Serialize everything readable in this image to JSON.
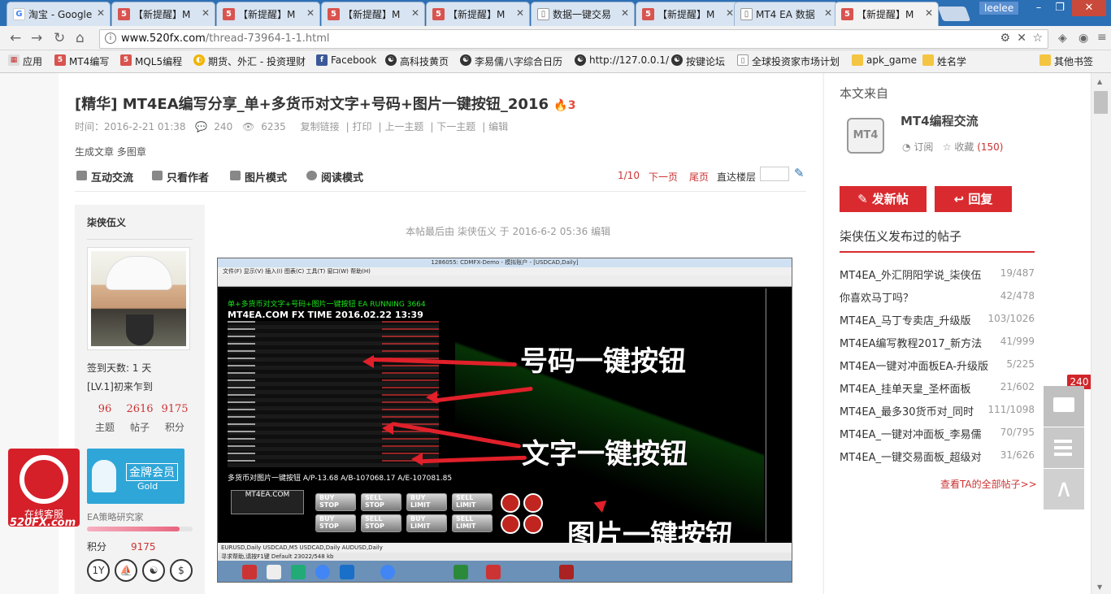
{
  "browser": {
    "tabs": [
      {
        "icon": "G",
        "label": "淘宝 - Google"
      },
      {
        "icon": "5",
        "label": "【新提醒】M"
      },
      {
        "icon": "5",
        "label": "【新提醒】M"
      },
      {
        "icon": "5",
        "label": "【新提醒】M"
      },
      {
        "icon": "5",
        "label": "【新提醒】M"
      },
      {
        "icon": "doc",
        "label": "数据一键交易"
      },
      {
        "icon": "5",
        "label": "【新提醒】M"
      },
      {
        "icon": "doc",
        "label": "MT4 EA 数据"
      },
      {
        "icon": "5",
        "label": "【新提醒】M"
      }
    ],
    "user": "leelee",
    "url_host": "www.520fx.com",
    "url_path": "/thread-73964-1-1.html",
    "bookmarks": [
      "应用",
      "MT4编写",
      "MQL5编程",
      "期货、外汇 - 投资理财",
      "Facebook",
      "高科技黄页",
      "李易儒八字综合日历",
      "http://127.0.0.1/",
      "按键论坛",
      "全球投资家市场计划",
      "apk_game",
      "姓名学",
      "其他书签"
    ]
  },
  "thread": {
    "title": "[精华] MT4EA编写分享_单+多货币对文字+号码+图片一键按钮_2016",
    "hot_icon": "fire-icon",
    "time": "时间：2016-2-21 01:38",
    "replies": "240",
    "views": "6235",
    "actions": [
      "复制链接",
      "打印",
      "上一主题",
      "下一主题",
      "编辑"
    ],
    "tags": "生成文章 多图章",
    "tools": [
      "互动交流",
      "只看作者",
      "图片模式",
      "阅读模式"
    ],
    "pager": {
      "page": "1/10",
      "next": "下一页",
      "last": "尾页",
      "jump": "直达楼层"
    },
    "edited_note": "本帖最后由 柒侠伍义 于 2016-6-2 05:36 编辑"
  },
  "author": {
    "name": "柒侠伍义",
    "sign_days": "签到天数: 1 天",
    "level": "[LV.1]初来乍到",
    "stats": [
      {
        "value": "96",
        "label": "主题"
      },
      {
        "value": "2616",
        "label": "帖子"
      },
      {
        "value": "9175",
        "label": "积分"
      }
    ],
    "medal_title": "金牌会员",
    "medal_sub": "Gold",
    "group": "EA策略研究家",
    "progress": 0.88,
    "score_label": "积分",
    "score_value": "9175",
    "badges": [
      "1Y",
      "⛵",
      "☯",
      "$"
    ]
  },
  "screenshot": {
    "window_title": "1286055: CDMFX-Demo - 模拟账户 - [USDCAD,Daily]",
    "menu": "文件(F)  显示(V)  插入(I)  图表(C)  工具(T)  窗口(W)  帮助(H)",
    "header_line1": "单+多货币对文字+号码+图片一键按钮 EA RUNNING  3664",
    "header_line2": "MT4EA.COM   FX TIME   2016.02.22 13:39",
    "footer": "多货币对图片一键按钮     A/P-13.68     A/B-107068.17   A/E-107081.85",
    "buttons": [
      "BUY STOP",
      "SELL STOP",
      "BUY LIMIT",
      "SELL LIMIT",
      "BUY STOP",
      "SELL STOP",
      "BUY LIMIT",
      "SELL LIMIT"
    ],
    "logo_text": "MT4EA.COM",
    "tabs": "EURUSD,Daily   USDCAD,M5   USDCAD,Daily   AUDUSD,Daily",
    "status": "寻求帮助,请按F1键                                 Default                                      23022/548 kb",
    "annotations": [
      "号码一键按钮",
      "文字一键按钮",
      "图片一键按钮"
    ]
  },
  "sidebar": {
    "from_label": "本文来自",
    "forum_name": "MT4编程交流",
    "logo_text": "MT4",
    "subscribe": "订阅",
    "favorite": "收藏",
    "favorite_count": "(150)",
    "post_button": "发新帖",
    "reply_button": "回复",
    "posts_title": "柒侠伍义发布过的帖子",
    "posts": [
      {
        "title": "MT4EA_外汇阴阳学说_柒侠伍",
        "count": "19/487"
      },
      {
        "title": "你喜欢马丁吗？",
        "count": "42/478"
      },
      {
        "title": "MT4EA_马丁专卖店_升级版",
        "count": "103/1026"
      },
      {
        "title": "MT4EA编写教程2017_新方法",
        "count": "41/999"
      },
      {
        "title": "MT4EA一键对冲面板EA-升级版",
        "count": "5/225"
      },
      {
        "title": "MT4EA_挂单天皇_圣杯面板",
        "count": "21/602"
      },
      {
        "title": "MT4EA_最多30货币对_同时",
        "count": "111/1098"
      },
      {
        "title": "MT4EA_一键对冲面板_李易儒",
        "count": "70/795"
      },
      {
        "title": "MT4EA_一键交易面板_超级对",
        "count": "31/626"
      }
    ],
    "more_link": "查看TA的全部帖子>>"
  },
  "float": {
    "bubble_count": "240"
  },
  "service": {
    "label": "在线客服",
    "brand": "520FX.com"
  }
}
